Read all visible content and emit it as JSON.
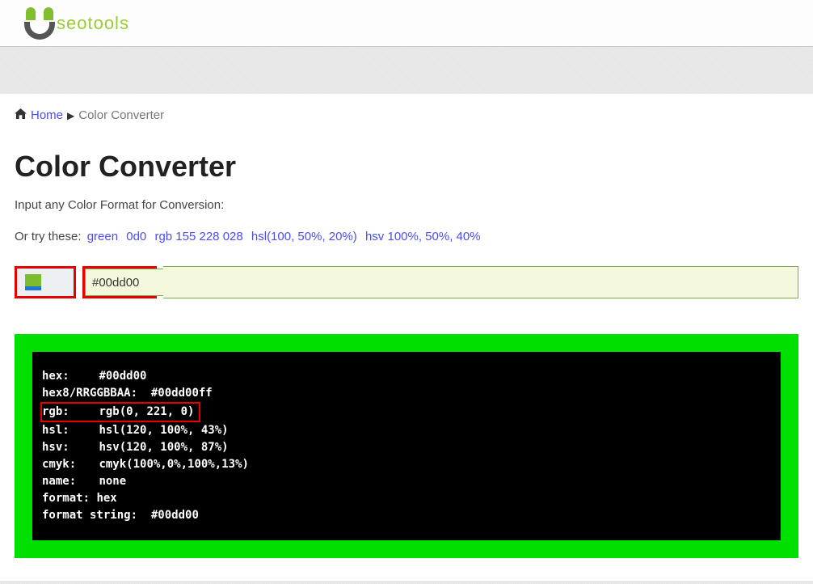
{
  "logo": {
    "text": "seotools"
  },
  "breadcrumb": {
    "home": "Home",
    "current": "Color Converter"
  },
  "title": "Color Converter",
  "subhead": "Input any Color Format for Conversion:",
  "examples": {
    "prefix": "Or try these:",
    "items": [
      "green",
      "0d0",
      "rgb 155 228 028",
      "hsl(100, 50%, 20%)",
      "hsv 100%, 50%, 40%"
    ]
  },
  "input": {
    "value": "#00dd00"
  },
  "output": {
    "hex_label": "hex:",
    "hex_value": "#00dd00",
    "hex8_label": "hex8/RRGGBBAA:",
    "hex8_value": "#00dd00ff",
    "rgb_label": "rgb:",
    "rgb_value": "rgb(0, 221, 0)",
    "hsl_label": "hsl:",
    "hsl_value": "hsl(120, 100%, 43%)",
    "hsv_label": "hsv:",
    "hsv_value": "hsv(120, 100%, 87%)",
    "cmyk_label": "cmyk:",
    "cmyk_value": "cmyk(100%,0%,100%,13%)",
    "name_label": "name:",
    "name_value": "none",
    "format_label": "format:",
    "format_value": "hex",
    "fstr_label": "format string:",
    "fstr_value": "#00dd00"
  }
}
